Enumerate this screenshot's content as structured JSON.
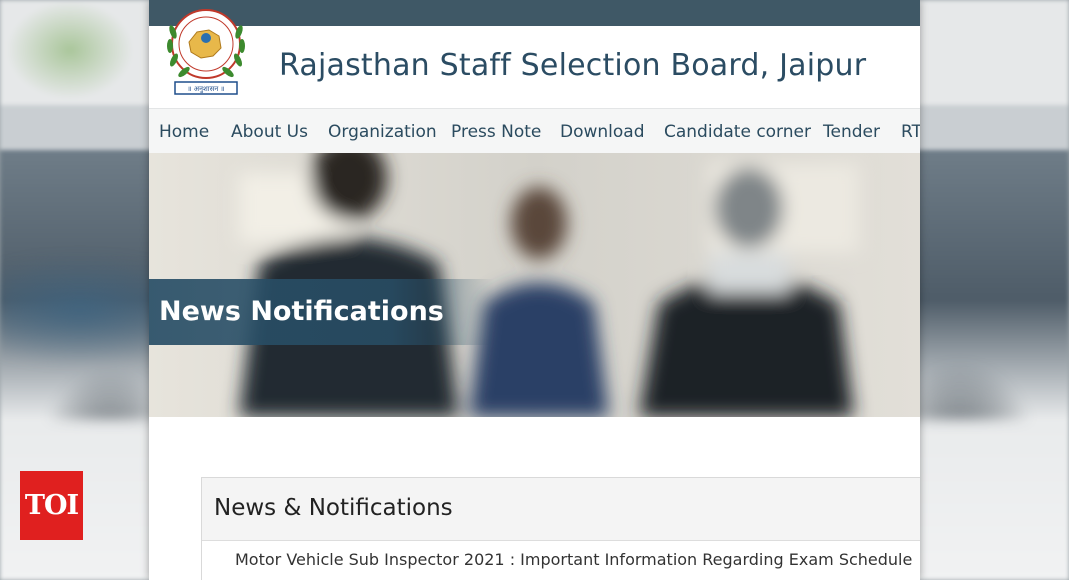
{
  "site": {
    "title": "Rajasthan Staff Selection Board, Jaipur",
    "logo_icon": "rsssb-emblem-icon",
    "logo_motto": "॥ अनुशासन ॥"
  },
  "nav": {
    "items": [
      {
        "label": "Home"
      },
      {
        "label": "About Us"
      },
      {
        "label": "Organization"
      },
      {
        "label": "Press Note"
      },
      {
        "label": "Download"
      },
      {
        "label": "Candidate corner"
      },
      {
        "label": "Tender"
      },
      {
        "label": "RT"
      }
    ]
  },
  "hero": {
    "title": "News Notifications"
  },
  "news": {
    "heading": "News & Notifications",
    "items": [
      {
        "text": "Motor Vehicle Sub Inspector 2021 : Important Information Regarding Exam Schedule"
      }
    ]
  },
  "watermark": {
    "text": "TOI"
  },
  "colors": {
    "topbar": "#3f5866",
    "title": "#2b4c63",
    "banner": "#284e66",
    "watermark": "#e0201f"
  }
}
